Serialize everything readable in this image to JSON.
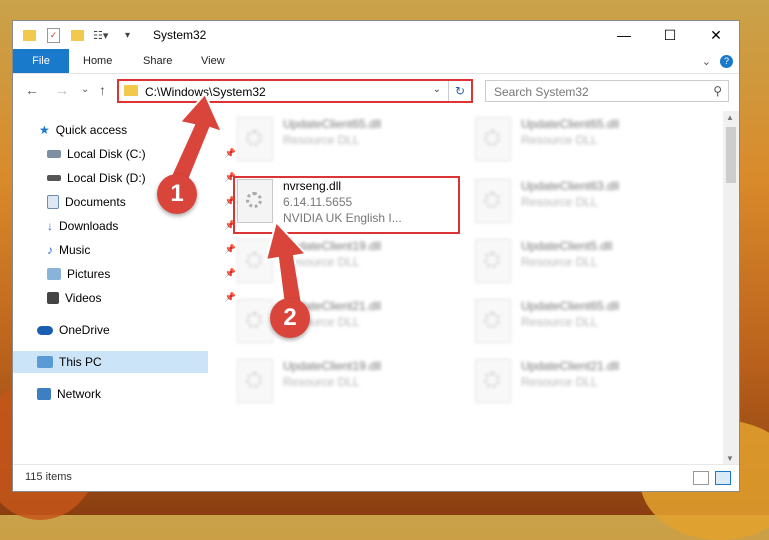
{
  "window": {
    "title": "System32"
  },
  "ribbon": {
    "file": "File",
    "home": "Home",
    "share": "Share",
    "view": "View"
  },
  "address": {
    "path": "C:\\Windows\\System32"
  },
  "search": {
    "placeholder": "Search System32"
  },
  "sidebar": {
    "items": [
      {
        "label": "Quick access",
        "icon": "star-icon"
      },
      {
        "label": "Local Disk (C:)",
        "icon": "drive-icon"
      },
      {
        "label": "Local Disk (D:)",
        "icon": "drive-icon"
      },
      {
        "label": "Documents",
        "icon": "documents-icon"
      },
      {
        "label": "Downloads",
        "icon": "download-icon"
      },
      {
        "label": "Music",
        "icon": "music-icon"
      },
      {
        "label": "Pictures",
        "icon": "pictures-icon"
      },
      {
        "label": "Videos",
        "icon": "videos-icon"
      },
      {
        "label": "OneDrive",
        "icon": "cloud-icon"
      },
      {
        "label": "This PC",
        "icon": "computer-icon"
      },
      {
        "label": "Network",
        "icon": "network-icon"
      }
    ]
  },
  "files": [
    {
      "name": "UpdateClient65.dll",
      "type": "Resource DLL"
    },
    {
      "name": "UpdateClient65.dll",
      "type": "Resource DLL"
    },
    {
      "name": "nvrseng.dll",
      "version": "6.14.11.5655",
      "desc": "NVIDIA UK English I..."
    },
    {
      "name": "UpdateClient63.dll",
      "type": "Resource DLL"
    },
    {
      "name": "UpdateClient19.dll",
      "type": "Resource DLL"
    },
    {
      "name": "UpdateClient5.dll",
      "type": "Resource DLL"
    },
    {
      "name": "UpdateClient21.dll",
      "type": "Resource DLL"
    },
    {
      "name": "UpdateClient65.dll",
      "type": "Resource DLL"
    },
    {
      "name": "UpdateClient19.dll",
      "type": "Resource DLL"
    },
    {
      "name": "UpdateClient21.dll",
      "type": "Resource DLL"
    }
  ],
  "status": {
    "count": "115 items"
  },
  "annotations": {
    "step1": "1",
    "step2": "2"
  },
  "colors": {
    "accent": "#1979ca",
    "highlight": "#d33333",
    "badge": "#d9453b"
  }
}
